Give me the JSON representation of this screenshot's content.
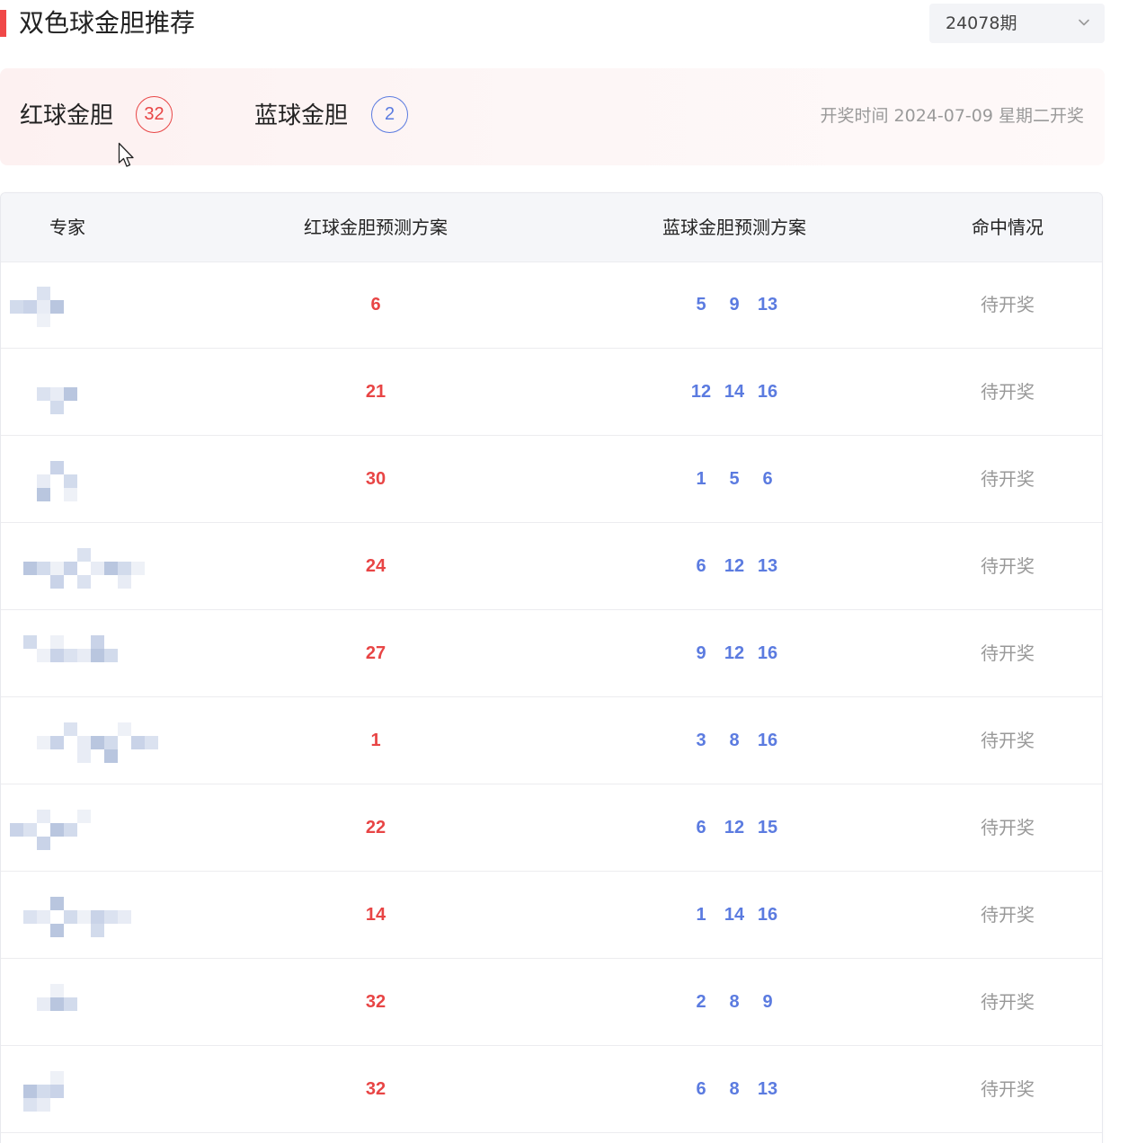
{
  "header": {
    "title": "双色球金胆推荐",
    "issue_selected": "24078期",
    "accent_color": "#f04848"
  },
  "summary": {
    "red_label": "红球金胆",
    "red_value": "32",
    "blue_label": "蓝球金胆",
    "blue_value": "2",
    "draw_time": "开奖时间 2024-07-09 星期二开奖"
  },
  "table": {
    "columns": [
      "专家",
      "红球金胆预测方案",
      "蓝球金胆预测方案",
      "命中情况"
    ],
    "rows": [
      {
        "red": "6",
        "blue": [
          "5",
          "9",
          "13"
        ],
        "status": "待开奖"
      },
      {
        "red": "21",
        "blue": [
          "12",
          "14",
          "16"
        ],
        "status": "待开奖"
      },
      {
        "red": "30",
        "blue": [
          "1",
          "5",
          "6"
        ],
        "status": "待开奖"
      },
      {
        "red": "24",
        "blue": [
          "6",
          "12",
          "13"
        ],
        "status": "待开奖"
      },
      {
        "red": "27",
        "blue": [
          "9",
          "12",
          "16"
        ],
        "status": "待开奖"
      },
      {
        "red": "1",
        "blue": [
          "3",
          "8",
          "16"
        ],
        "status": "待开奖"
      },
      {
        "red": "22",
        "blue": [
          "6",
          "12",
          "15"
        ],
        "status": "待开奖"
      },
      {
        "red": "14",
        "blue": [
          "1",
          "14",
          "16"
        ],
        "status": "待开奖"
      },
      {
        "red": "32",
        "blue": [
          "2",
          "8",
          "9"
        ],
        "status": "待开奖"
      },
      {
        "red": "32",
        "blue": [
          "6",
          "8",
          "13"
        ],
        "status": "待开奖"
      }
    ]
  },
  "colors": {
    "red_ball": "#e84545",
    "blue_ball": "#5b7be0",
    "status": "#999999"
  },
  "icons": {
    "dropdown": "chevron-down-icon",
    "cursor": "mouse-pointer-icon"
  }
}
